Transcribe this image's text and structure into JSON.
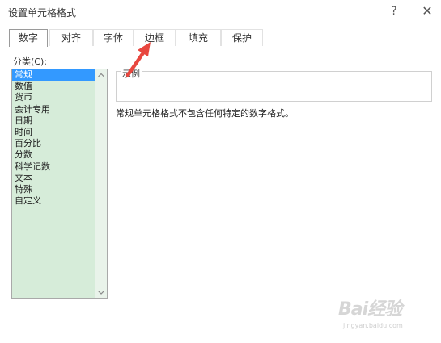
{
  "window": {
    "title": "设置单元格格式",
    "help_glyph": "?",
    "close_glyph": "✕"
  },
  "tabs": [
    {
      "label": "数字",
      "active": true
    },
    {
      "label": "对齐",
      "active": false
    },
    {
      "label": "字体",
      "active": false
    },
    {
      "label": "边框",
      "active": false
    },
    {
      "label": "填充",
      "active": false
    },
    {
      "label": "保护",
      "active": false
    }
  ],
  "category": {
    "label": "分类(C):",
    "items": [
      "常规",
      "数值",
      "货币",
      "会计专用",
      "日期",
      "时间",
      "百分比",
      "分数",
      "科学记数",
      "文本",
      "特殊",
      "自定义"
    ],
    "selected_index": 0
  },
  "sample": {
    "legend": "示例"
  },
  "description": "常规单元格格式不包含任何特定的数字格式。",
  "watermark": {
    "brand": "Bai经验",
    "domain": "jingyan.baidu.com"
  },
  "colors": {
    "list_background": "#d6ecd9",
    "selection": "#3399ff",
    "annotation_arrow": "#e8473f"
  },
  "icons": {
    "help": "help-icon",
    "close": "close-icon",
    "scroll_up": "chevron-up-icon",
    "scroll_down": "chevron-down-icon",
    "pointer_arrow": "annotation-arrow-icon"
  }
}
